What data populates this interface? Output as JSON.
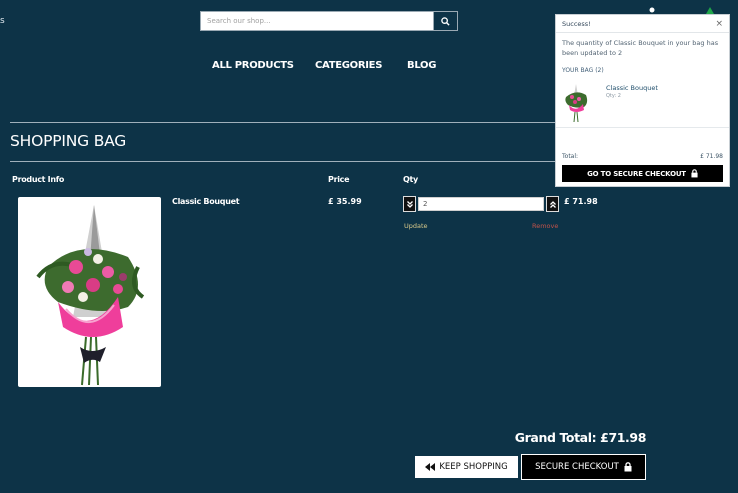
{
  "header": {
    "edge_text": "s",
    "search": {
      "placeholder": "Search our shop...",
      "icon": "search-icon"
    }
  },
  "nav": {
    "items": [
      {
        "label": "ALL PRODUCTS"
      },
      {
        "label": "CATEGORIES"
      },
      {
        "label": "BLOG"
      }
    ]
  },
  "page": {
    "title": "SHOPPING BAG"
  },
  "table": {
    "headers": {
      "product": "Product Info",
      "price": "Price",
      "qty": "Qty"
    },
    "rows": [
      {
        "name": "Classic Bouquet",
        "price": "£ 35.99",
        "qty": "2",
        "total": "£ 71.98",
        "update_label": "Update",
        "remove_label": "Remove"
      }
    ]
  },
  "footer": {
    "grand_total": "Grand Total: £71.98",
    "keep_shopping": "KEEP SHOPPING",
    "secure_checkout": "SECURE CHECKOUT"
  },
  "popup": {
    "title": "Success!",
    "close": "×",
    "message": "The quantity of Classic Bouquet in your bag has been updated to 2",
    "bag_label": "YOUR BAG (2)",
    "item_name": "Classic Bouquet",
    "item_qty": "Qty: 2",
    "total_label": "Total:",
    "total_value": "£ 71.98",
    "checkout_label": "GO TO SECURE CHECKOUT"
  },
  "colors": {
    "background": "#0d3347",
    "button_dark": "#000000",
    "remove": "#c0524a",
    "update": "#d8c98a"
  }
}
